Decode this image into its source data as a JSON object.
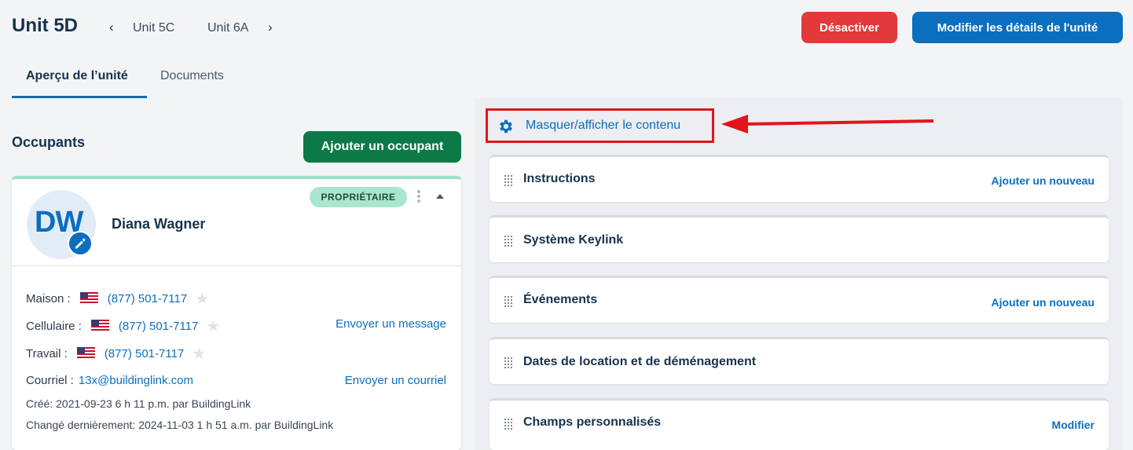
{
  "header": {
    "unit_title": "Unit 5D",
    "prev_unit": "Unit 5C",
    "next_unit": "Unit 6A",
    "deactivate_label": "Désactiver",
    "edit_label": "Modifier les détails de l'unité"
  },
  "tabs": [
    {
      "label": "Aperçu de l’unité",
      "active": true
    },
    {
      "label": "Documents",
      "active": false
    }
  ],
  "occupants": {
    "title": "Occupants",
    "add_label": "Ajouter un occupant",
    "card": {
      "initials": "DW",
      "name": "Diana Wagner",
      "role": "PROPRIÉTAIRE",
      "phones": [
        {
          "label": "Maison :",
          "number": "(877) 501-7117"
        },
        {
          "label": "Cellulaire :",
          "number": "(877) 501-7117",
          "action": "Envoyer un message"
        },
        {
          "label": "Travail :",
          "number": "(877) 501-7117"
        }
      ],
      "email_label": "Courriel :",
      "email": "13x@buildinglink.com",
      "email_action": "Envoyer un courriel",
      "created": "Créé:  2021-09-23 6 h 11 p.m. par BuildingLink",
      "changed": "Changé dernièrement:  2024-11-03 1 h 51 a.m. par BuildingLink"
    }
  },
  "content_panel": {
    "show_hide_label": "Masquer/afficher le contenu",
    "sections": [
      {
        "title": "Instructions",
        "action": "Ajouter un nouveau"
      },
      {
        "title": "Système Keylink",
        "action": ""
      },
      {
        "title": "Événements",
        "action": "Ajouter un nouveau"
      },
      {
        "title": "Dates de location et de déménagement",
        "action": ""
      },
      {
        "title": "Champs personnalisés",
        "action": "Modifier"
      }
    ]
  },
  "colors": {
    "primary": "#0b6ebf",
    "danger": "#e2393a",
    "success": "#0b7a46",
    "badge": "#a8e6cf",
    "highlight": "#e0161b"
  }
}
